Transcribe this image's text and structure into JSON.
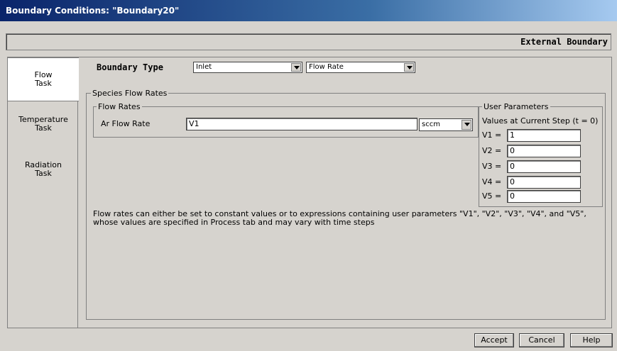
{
  "window": {
    "title": "Boundary Conditions: \"Boundary20\""
  },
  "banner": {
    "text": "External Boundary"
  },
  "tabs": [
    {
      "label": "Flow Task"
    },
    {
      "label": "Temperature Task"
    },
    {
      "label": "Radiation Task"
    }
  ],
  "boundary_type": {
    "label": "Boundary Type",
    "type_value": "Inlet",
    "mode_value": "Flow Rate"
  },
  "species_group": {
    "legend": "Species Flow Rates",
    "flow_rates_legend": "Flow Rates",
    "ar_label": "Ar Flow Rate",
    "ar_value": "V1",
    "ar_unit": "sccm"
  },
  "user_params": {
    "legend": "User Parameters",
    "caption": "Values at Current Step (t = 0)",
    "items": [
      {
        "label": "V1 =",
        "value": "1"
      },
      {
        "label": "V2 =",
        "value": "0"
      },
      {
        "label": "V3 =",
        "value": "0"
      },
      {
        "label": "V4 =",
        "value": "0"
      },
      {
        "label": "V5 =",
        "value": "0"
      }
    ]
  },
  "note": {
    "line1": "Flow rates can either be set to constant values or to expressions containing user parameters \"V1\", \"V2\", \"V3\", \"V4\", and \"V5\",",
    "line2": "whose values are specified in Process tab and may vary with time steps"
  },
  "buttons": {
    "accept": "Accept",
    "cancel": "Cancel",
    "help": "Help"
  }
}
